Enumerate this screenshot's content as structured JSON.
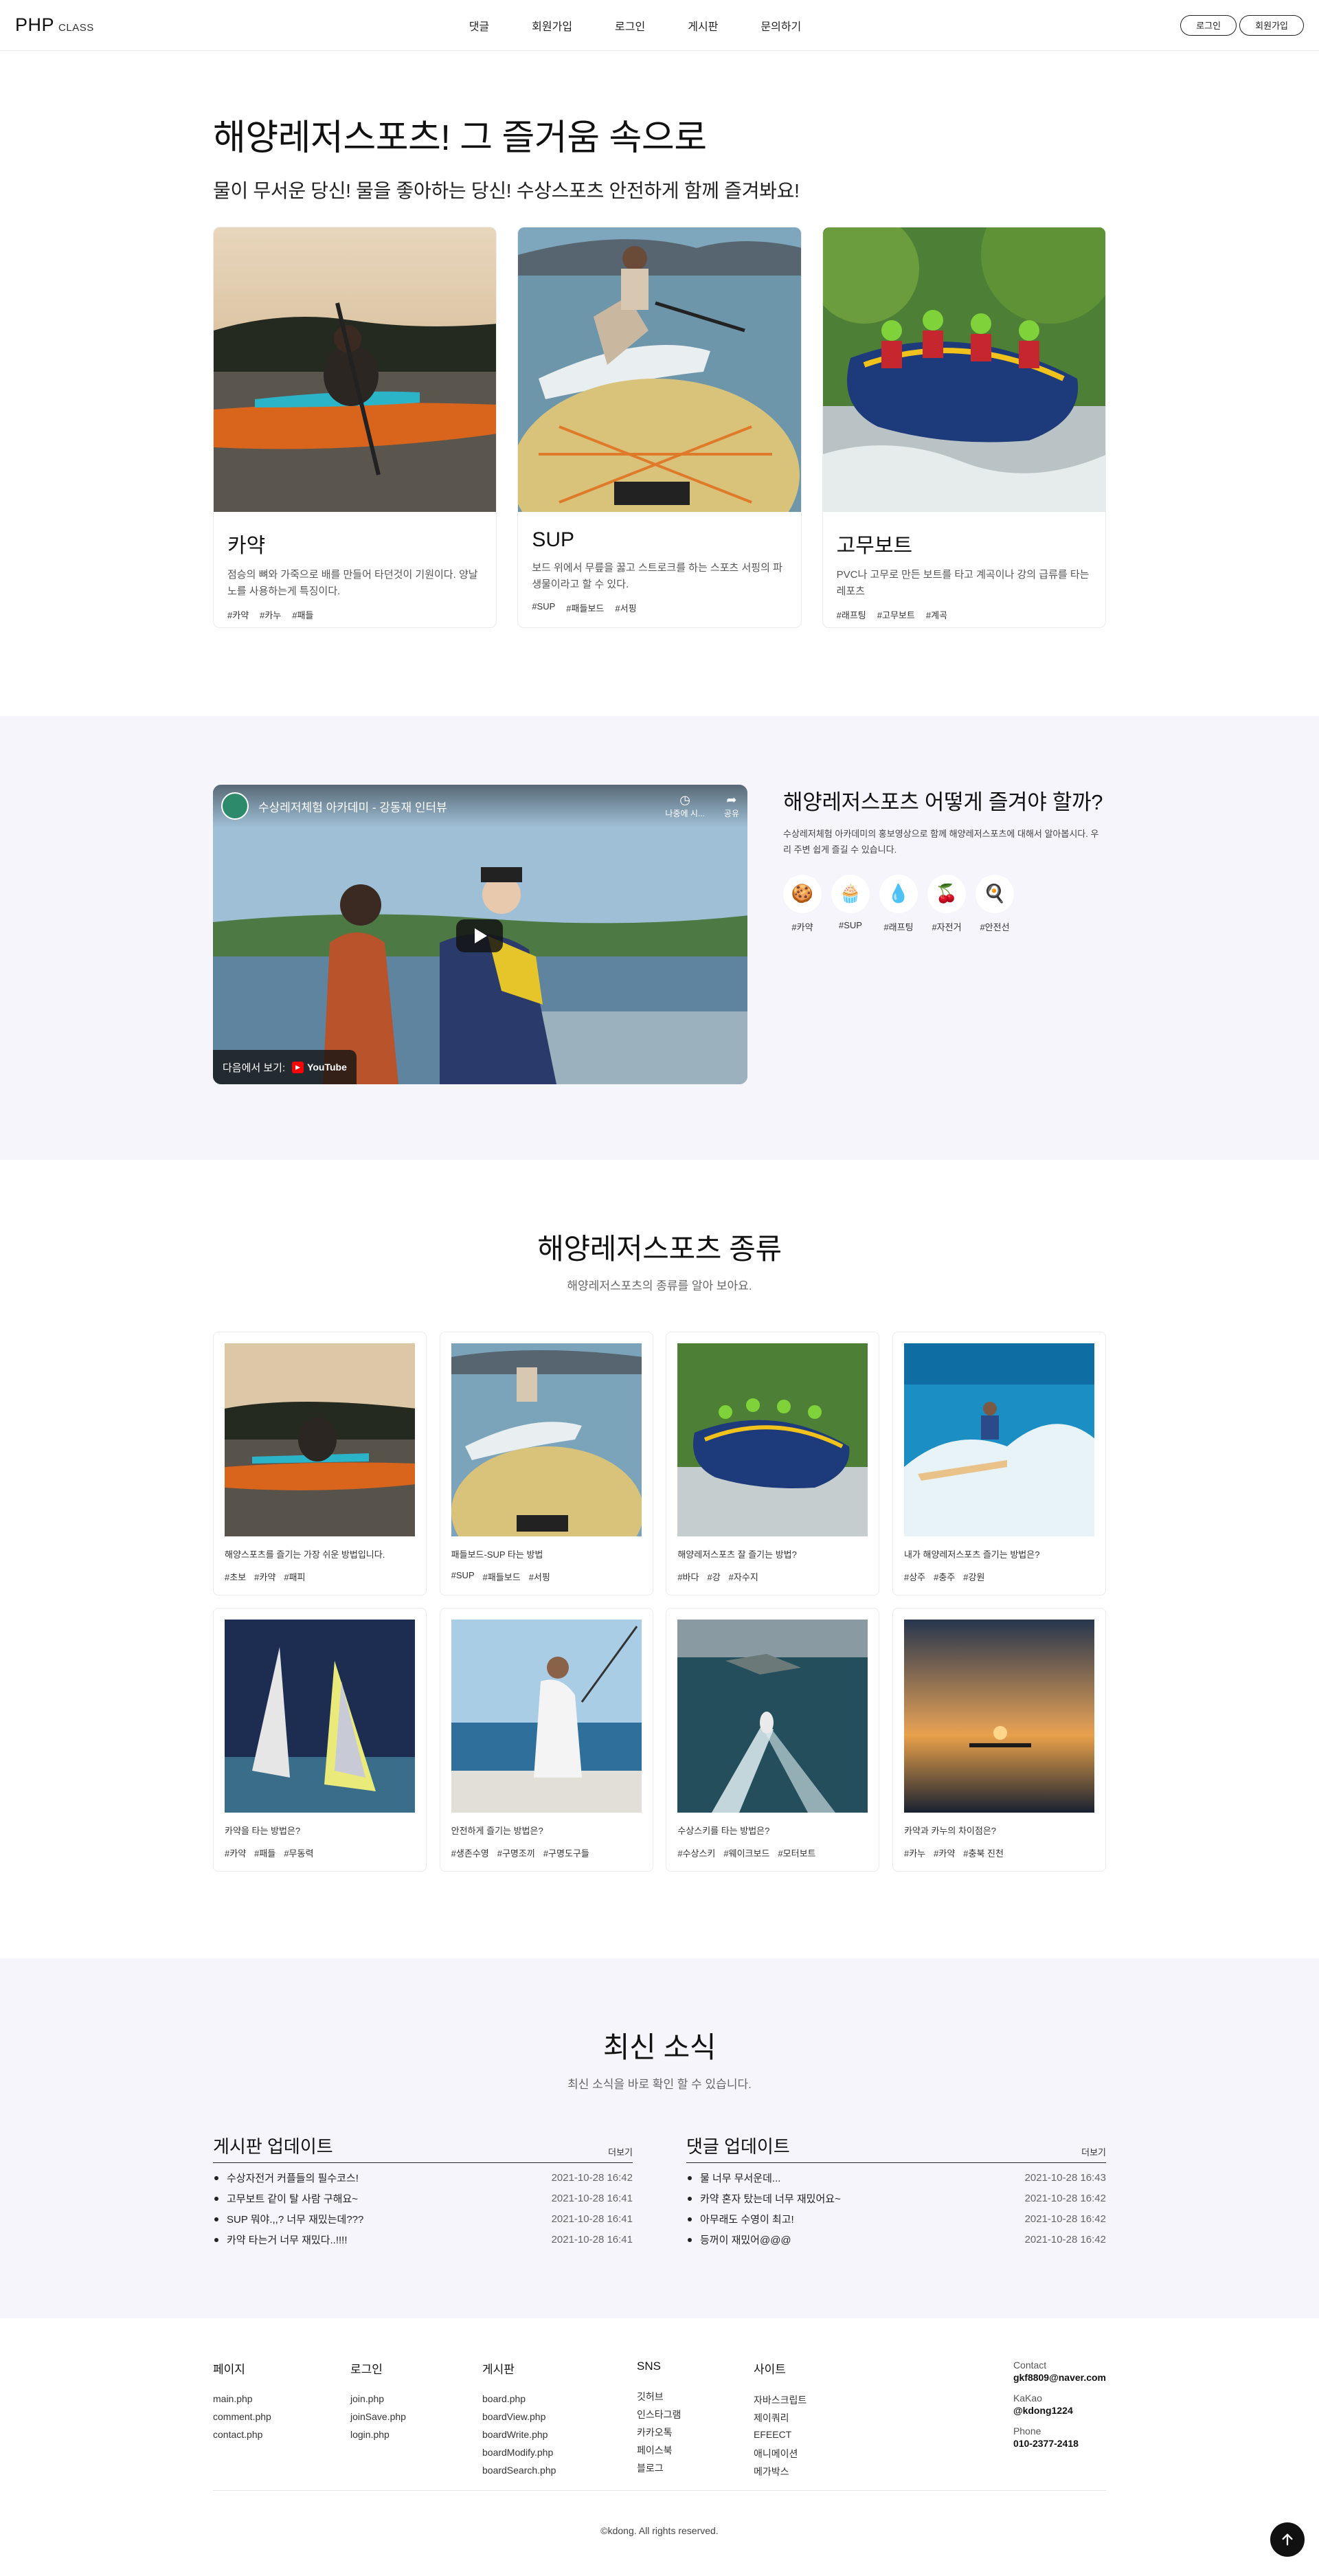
{
  "header": {
    "logo_main": "PHP",
    "logo_sub": "CLASS",
    "nav": [
      "댓글",
      "회원가입",
      "로그인",
      "게시판",
      "문의하기"
    ],
    "login": "로그인",
    "join": "회원가입"
  },
  "intro": {
    "title": "해양레저스포츠! 그 즐거움 속으로",
    "lead": "물이 무서운 당신! 물을 좋아하는 당신! 수상스포츠 안전하게 함께 즐겨봐요!",
    "cards": [
      {
        "title": "카약",
        "desc": "점승의 뼈와 가죽으로 배를 만들어 타던것이 기원이다. 양날 노를 사용하는게 특징이다.",
        "tags": [
          "#카약",
          "#카누",
          "#패들"
        ]
      },
      {
        "title": "SUP",
        "desc": "보드 위에서 무릎을 꿇고 스트로크를 하는 스포츠 서핑의 파생물이라고 할 수 있다.",
        "tags": [
          "#SUP",
          "#패들보드",
          "#서핑"
        ]
      },
      {
        "title": "고무보트",
        "desc": "PVC나 고무로 만든 보트를 타고 계곡이나 강의 급류를 타는 레포츠",
        "tags": [
          "#래프팅",
          "#고무보트",
          "#계곡"
        ]
      }
    ]
  },
  "video": {
    "title": "수상레저체험 아카데미 - 강동재 인터뷰",
    "later": "나중에 시...",
    "share": "공유",
    "watch_on": "다음에서 보기:",
    "youtube": "YouTube"
  },
  "howto": {
    "title": "해양레저스포츠 어떻게 즐겨야 할까?",
    "desc": "수상레저체험 아카데미의 홍보영상으로 함께 해양레저스포츠에 대해서 알아봅시다. 우리 주변 쉽게 즐길 수 있습니다.",
    "icons": [
      {
        "label": "#카약",
        "emoji": "🍪"
      },
      {
        "label": "#SUP",
        "emoji": "🧁"
      },
      {
        "label": "#래프팅",
        "emoji": "💧"
      },
      {
        "label": "#자전거",
        "emoji": "🍒"
      },
      {
        "label": "#안전선",
        "emoji": "🍳"
      }
    ]
  },
  "types": {
    "title": "해양레저스포츠 종류",
    "sub": "해양레저스포츠의 종류를 알아 보아요.",
    "cards": [
      {
        "desc": "해양스포츠를 즐기는 가장 쉬운 방법입니다.",
        "tags": [
          "#초보",
          "#카약",
          "#패피"
        ]
      },
      {
        "desc": "패들보드-SUP 타는 방법",
        "tags": [
          "#SUP",
          "#패들보드",
          "#서핑"
        ]
      },
      {
        "desc": "해양레저스포츠 잘 즐기는 방법?",
        "tags": [
          "#바다",
          "#강",
          "#자수지"
        ]
      },
      {
        "desc": "내가 해양레저스포츠 즐기는 방법은?",
        "tags": [
          "#상주",
          "#충주",
          "#강원"
        ]
      },
      {
        "desc": "카약을 타는 방법은?",
        "tags": [
          "#카약",
          "#패들",
          "#무동력"
        ]
      },
      {
        "desc": "안전하게 즐기는 방법은?",
        "tags": [
          "#생존수영",
          "#구명조끼",
          "#구명도구들"
        ]
      },
      {
        "desc": "수상스키를 타는 방법은?",
        "tags": [
          "#수상스키",
          "#웨이크보드",
          "#모터보트"
        ]
      },
      {
        "desc": "카약과 카누의 차이점은?",
        "tags": [
          "#카누",
          "#카약",
          "#충북 진천"
        ]
      }
    ]
  },
  "news": {
    "title": "최신 소식",
    "sub": "최신 소식을 바로 확인 할 수 있습니다.",
    "boards": [
      {
        "title": "게시판 업데이트",
        "more": "더보기",
        "rows": [
          {
            "text": "수상자전거 커플들의 필수코스!",
            "date": "2021-10-28 16:42"
          },
          {
            "text": "고무보트 같이 탈 사람 구해요~",
            "date": "2021-10-28 16:41"
          },
          {
            "text": "SUP 뭐야.,,? 너무 재밌는데???",
            "date": "2021-10-28 16:41"
          },
          {
            "text": "카약 타는거 너무 재밌다..!!!!",
            "date": "2021-10-28 16:41"
          }
        ]
      },
      {
        "title": "댓글 업데이트",
        "more": "더보기",
        "rows": [
          {
            "text": "물 너무 무서운데...",
            "date": "2021-10-28 16:43"
          },
          {
            "text": "카약 혼자 탔는데 너무 재밌어요~",
            "date": "2021-10-28 16:42"
          },
          {
            "text": "아무래도 수영이 최고!",
            "date": "2021-10-28 16:42"
          },
          {
            "text": "등꺼이 재밌어@@@",
            "date": "2021-10-28 16:42"
          }
        ]
      }
    ]
  },
  "footer": {
    "cols": [
      {
        "title": "페이지",
        "items": [
          "main.php",
          "comment.php",
          "contact.php"
        ]
      },
      {
        "title": "로그인",
        "items": [
          "join.php",
          "joinSave.php",
          "login.php"
        ]
      },
      {
        "title": "게시판",
        "items": [
          "board.php",
          "boardView.php",
          "boardWrite.php",
          "boardModify.php",
          "boardSearch.php"
        ]
      },
      {
        "title": "SNS",
        "items": [
          "깃허브",
          "인스타그램",
          "카카오톡",
          "페이스북",
          "블로그"
        ]
      },
      {
        "title": "사이트",
        "items": [
          "자바스크립트",
          "제이쿼리",
          "EFEECT",
          "애니메이션",
          "메가박스"
        ]
      }
    ],
    "contact": [
      {
        "label": "Contact",
        "value": "gkf8809@naver.com"
      },
      {
        "label": "KaKao",
        "value": "@kdong1224"
      },
      {
        "label": "Phone",
        "value": "010-2377-2418"
      }
    ],
    "copyright": "©kdong. All rights reserved."
  }
}
